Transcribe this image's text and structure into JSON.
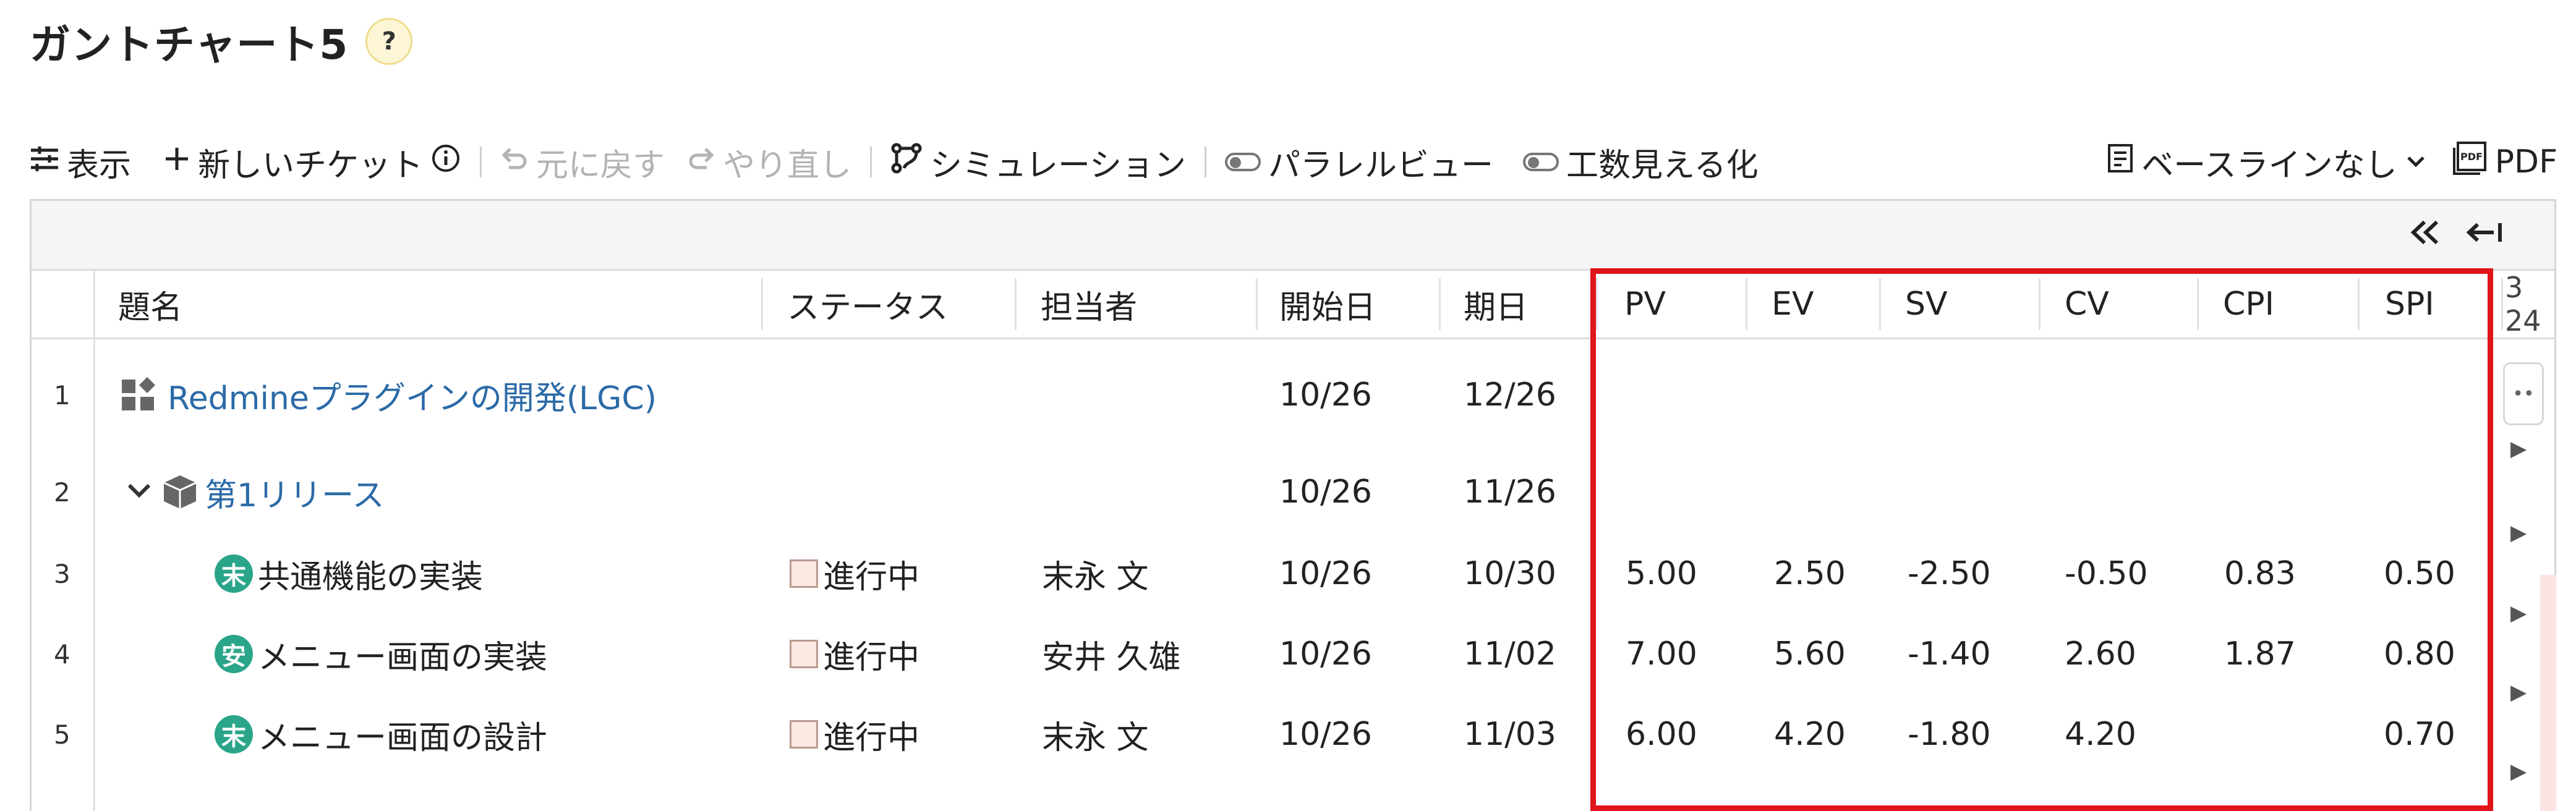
{
  "page": {
    "title": "ガントチャート5",
    "help": "?"
  },
  "toolbar": {
    "display_label": "表示",
    "new_ticket_label": "新しいチケット",
    "undo_label": "元に戻す",
    "redo_label": "やり直し",
    "simulation_label": "シミュレーション",
    "parallel_view_label": "パラレルビュー",
    "effort_visual_label": "工数見える化",
    "baseline_label": "ベースラインなし",
    "pdf_label": "PDF"
  },
  "grid": {
    "columns": [
      "題名",
      "ステータス",
      "担当者",
      "開始日",
      "期日",
      "PV",
      "EV",
      "SV",
      "CV",
      "CPI",
      "SPI"
    ],
    "timeline_partial_header": "3 24",
    "rows": [
      {
        "num": "1",
        "title": "Redmineプラグインの開発(LGC)",
        "icon": "project-icon",
        "status": "",
        "assignee": "",
        "avatar": "",
        "start": "10/26",
        "due": "12/26",
        "pv": "",
        "ev": "",
        "sv": "",
        "cv": "",
        "cpi": "",
        "spi": ""
      },
      {
        "num": "2",
        "title": "第1リリース",
        "icon": "version-icon",
        "status": "",
        "assignee": "",
        "avatar": "",
        "start": "10/26",
        "due": "11/26",
        "pv": "",
        "ev": "",
        "sv": "",
        "cv": "",
        "cpi": "",
        "spi": ""
      },
      {
        "num": "3",
        "title": "共通機能の実装",
        "icon": "avatar",
        "status": "進行中",
        "assignee": "末永 文",
        "avatar": "末",
        "start": "10/26",
        "due": "10/30",
        "pv": "5.00",
        "ev": "2.50",
        "sv": "-2.50",
        "cv": "-0.50",
        "cpi": "0.83",
        "spi": "0.50"
      },
      {
        "num": "4",
        "title": "メニュー画面の実装",
        "icon": "avatar",
        "status": "進行中",
        "assignee": "安井 久雄",
        "avatar": "安",
        "start": "10/26",
        "due": "11/02",
        "pv": "7.00",
        "ev": "5.60",
        "sv": "-1.40",
        "cv": "2.60",
        "cpi": "1.87",
        "spi": "0.80"
      },
      {
        "num": "5",
        "title": "メニュー画面の設計",
        "icon": "avatar",
        "status": "進行中",
        "assignee": "末永 文",
        "avatar": "末",
        "start": "10/26",
        "due": "11/03",
        "pv": "6.00",
        "ev": "4.20",
        "sv": "-1.80",
        "cv": "4.20",
        "cpi": "",
        "spi": "0.70"
      }
    ]
  },
  "colors": {
    "link": "#2b6aa7",
    "highlight": "#e0141a",
    "avatar": "#2aa58a"
  }
}
